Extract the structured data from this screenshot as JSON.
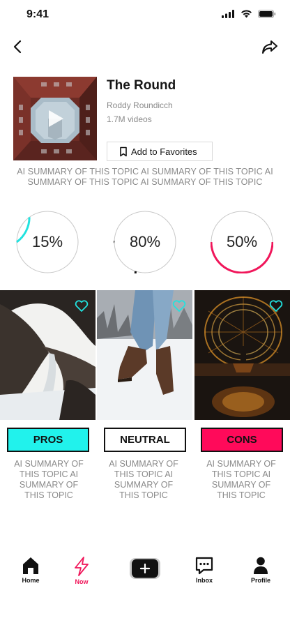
{
  "status": {
    "time": "9:41"
  },
  "header": {
    "back_icon": "chevron-left-icon",
    "share_icon": "share-arrow-icon"
  },
  "topic": {
    "title": "The Round",
    "author": "Roddy Roundicch",
    "videos": "1.7M videos",
    "favorite_label": "Add to Favorites",
    "summary": "AI SUMMARY OF THIS TOPIC AI SUMMARY OF THIS TOPIC AI SUMMARY OF THIS TOPIC  AI SUMMARY OF THIS TOPIC"
  },
  "stats": [
    {
      "label": "15%",
      "value": 0.15,
      "color": "#21e2df"
    },
    {
      "label": "80%",
      "value": 0.8,
      "color": "#111111"
    },
    {
      "label": "50%",
      "value": 0.5,
      "color": "#f0165a"
    }
  ],
  "columns": [
    {
      "tag": "PROS",
      "tag_color": "#21f2ec",
      "summary": "AI SUMMARY OF THIS TOPIC AI SUMMARY OF THIS TOPIC"
    },
    {
      "tag": "NEUTRAL",
      "tag_color": "#ffffff",
      "summary": "AI SUMMARY OF THIS TOPIC AI SUMMARY OF THIS TOPIC"
    },
    {
      "tag": "CONS",
      "tag_color": "#ff0a5a",
      "summary": "AI SUMMARY OF THIS TOPIC AI SUMMARY OF THIS TOPIC"
    }
  ],
  "tabbar": {
    "home": "Home",
    "now": "Now",
    "inbox": "Inbox",
    "profile": "Profile",
    "active": "now"
  },
  "colors": {
    "accent_cyan": "#21e2df",
    "accent_pink": "#f0165a"
  }
}
